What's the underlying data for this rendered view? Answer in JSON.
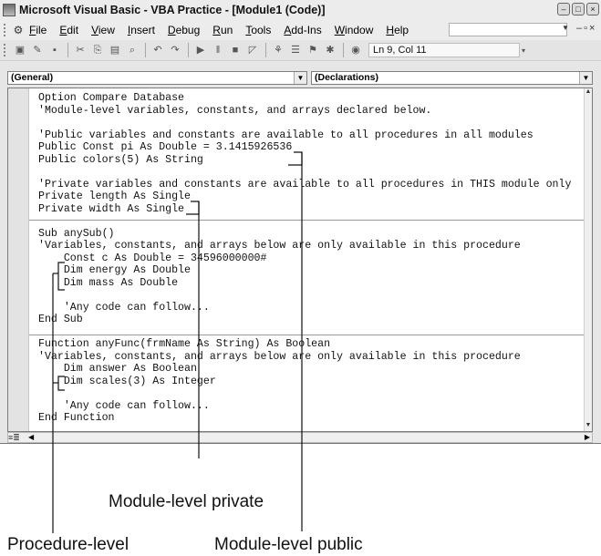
{
  "window": {
    "title": "Microsoft Visual Basic - VBA Practice - [Module1 (Code)]"
  },
  "menubar": {
    "items": [
      {
        "label": "File",
        "accel": "F",
        "rest": "ile"
      },
      {
        "label": "Edit",
        "accel": "E",
        "rest": "dit"
      },
      {
        "label": "View",
        "accel": "V",
        "rest": "iew"
      },
      {
        "label": "Insert",
        "accel": "I",
        "rest": "nsert"
      },
      {
        "label": "Debug",
        "accel": "D",
        "rest": "ebug"
      },
      {
        "label": "Run",
        "accel": "R",
        "rest": "un"
      },
      {
        "label": "Tools",
        "accel": "T",
        "rest": "ools"
      },
      {
        "label": "Add-Ins",
        "accel": "A",
        "rest": "dd-Ins"
      },
      {
        "label": "Window",
        "accel": "W",
        "rest": "indow"
      },
      {
        "label": "Help",
        "accel": "H",
        "rest": "elp"
      }
    ]
  },
  "toolbar": {
    "status": "Ln 9, Col 11"
  },
  "combos": {
    "object": "(General)",
    "procedure": "(Declarations)"
  },
  "code": {
    "lines": [
      "Option Compare Database",
      "'Module-level variables, constants, and arrays declared below.",
      "",
      "'Public variables and constants are available to all procedures in all modules",
      "Public Const pi As Double = 3.1415926536",
      "Public colors(5) As String",
      "",
      "'Private variables and constants are available to all procedures in THIS module only",
      "Private length As Single",
      "Private width As Single",
      "",
      "Sub anySub()",
      "'Variables, constants, and arrays below are only available in this procedure",
      "    Const c As Double = 34596000000#",
      "    Dim energy As Double",
      "    Dim mass As Double",
      "",
      "    'Any code can follow...",
      "End Sub",
      "",
      "Function anyFunc(frmName As String) As Boolean",
      "'Variables, constants, and arrays below are only available in this procedure",
      "    Dim answer As Boolean",
      "    Dim scales(3) As Integer",
      "",
      "    'Any code can follow...",
      "End Function"
    ]
  },
  "callouts": {
    "module_private": "Module-level private",
    "procedure_level": "Procedure-level",
    "module_public": "Module-level public"
  }
}
